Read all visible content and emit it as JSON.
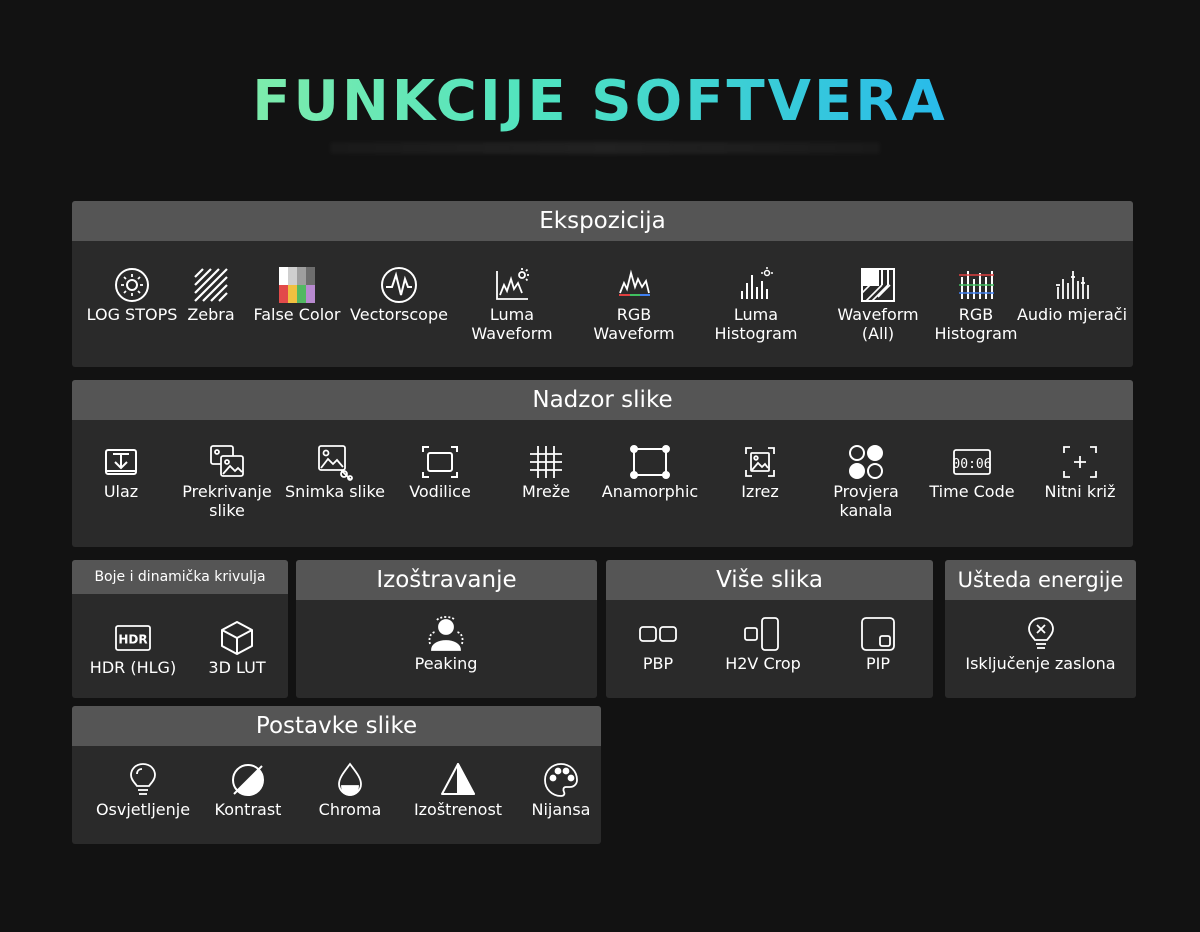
{
  "title": "FUNKCIJE SOFTVERA",
  "colors": {
    "background": "#121212",
    "panel": "#2a2a2a",
    "header": "#555555",
    "title_gradient": [
      "#a6f39a",
      "#4fe3c0",
      "#27b9ec",
      "#1f8fe8"
    ]
  },
  "sections": {
    "ekspozicija": {
      "header": "Ekspozicija",
      "items": [
        {
          "icon": "sun-circle-icon",
          "label": "LOG STOPS"
        },
        {
          "icon": "zebra-stripes-icon",
          "label": "Zebra"
        },
        {
          "icon": "false-color-grid-icon",
          "label": "False Color"
        },
        {
          "icon": "vectorscope-icon",
          "label": "Vectorscope"
        },
        {
          "icon": "luma-waveform-icon",
          "label": "Luma",
          "label2": "Waveform"
        },
        {
          "icon": "rgb-waveform-icon",
          "label": "RGB",
          "label2": "Waveform"
        },
        {
          "icon": "luma-histogram-icon",
          "label": "Luma",
          "label2": "Histogram"
        },
        {
          "icon": "waveform-all-icon",
          "label": "Waveform",
          "label2": "(All)"
        },
        {
          "icon": "rgb-histogram-icon",
          "label": "RGB",
          "label2": "Histogram"
        },
        {
          "icon": "audio-meter-icon",
          "label": "Audio mjerači"
        }
      ]
    },
    "nadzor": {
      "header": "Nadzor slike",
      "items": [
        {
          "icon": "input-icon",
          "label": "Ulaz"
        },
        {
          "icon": "overlay-image-icon",
          "label": "Prekrivanje",
          "label2": "slike"
        },
        {
          "icon": "snapshot-icon",
          "label": "Snimka slike"
        },
        {
          "icon": "guides-icon",
          "label": "Vodilice"
        },
        {
          "icon": "grid-icon",
          "label": "Mreže"
        },
        {
          "icon": "anamorphic-icon",
          "label": "Anamorphic"
        },
        {
          "icon": "crop-icon",
          "label": "Izrez"
        },
        {
          "icon": "channel-check-icon",
          "label": "Provjera",
          "label2": "kanala"
        },
        {
          "icon": "time-code-icon",
          "label": "Time Code",
          "code_text": "00:06"
        },
        {
          "icon": "crosshair-icon",
          "label": "Nitni križ"
        }
      ]
    },
    "boje": {
      "header": "Boje i dinamička krivulja",
      "items": [
        {
          "icon": "hdr-icon",
          "label": "HDR (HLG)",
          "badge": "HDR"
        },
        {
          "icon": "cube-3d-lut-icon",
          "label": "3D LUT"
        }
      ]
    },
    "izostravanje": {
      "header": "Izoštravanje",
      "items": [
        {
          "icon": "peaking-person-icon",
          "label": "Peaking"
        }
      ]
    },
    "vise": {
      "header": "Više slika",
      "items": [
        {
          "icon": "pbp-icon",
          "label": "PBP"
        },
        {
          "icon": "h2v-crop-icon",
          "label": "H2V Crop"
        },
        {
          "icon": "pip-icon",
          "label": "PIP"
        }
      ]
    },
    "usteda": {
      "header": "Ušteda energije",
      "items": [
        {
          "icon": "bulb-off-icon",
          "label": "Isključenje zaslona"
        }
      ]
    },
    "postavke": {
      "header": "Postavke slike",
      "items": [
        {
          "icon": "bulb-icon",
          "label": "Osvjetljenje"
        },
        {
          "icon": "contrast-icon",
          "label": "Kontrast"
        },
        {
          "icon": "chroma-drop-icon",
          "label": "Chroma"
        },
        {
          "icon": "sharpness-triangle-icon",
          "label": "Izoštrenost"
        },
        {
          "icon": "palette-icon",
          "label": "Nijansa"
        }
      ]
    }
  }
}
